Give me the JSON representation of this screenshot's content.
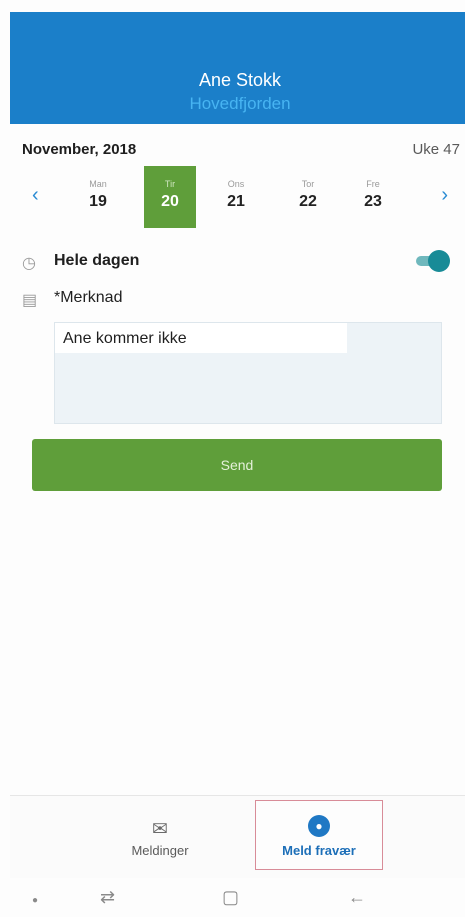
{
  "header": {
    "name": "Ane Stokk",
    "school": "Hovedfjorden"
  },
  "calendar": {
    "month": "November, 2018",
    "week": "Uke 47",
    "prev_icon": "chevron-left-icon",
    "next_icon": "chevron-right-icon",
    "days": [
      {
        "name": "Man",
        "num": "19"
      },
      {
        "name": "Tir",
        "num": "20"
      },
      {
        "name": "Ons",
        "num": "21"
      },
      {
        "name": "Tor",
        "num": "22"
      },
      {
        "name": "Fre",
        "num": "23"
      }
    ],
    "selected_day": "20"
  },
  "form": {
    "all_day_label": "Hele dagen",
    "all_day_on": true,
    "note_label": "*Merknad",
    "note_value": "Ane kommer ikke",
    "send_label": "Send"
  },
  "bottom_nav": {
    "items": [
      {
        "label": "Meldinger",
        "icon": "envelope-icon"
      },
      {
        "label": "Meld fravær",
        "icon": "report-absence-icon"
      }
    ],
    "active": "Meld fravær"
  },
  "colors": {
    "header": "#1b7fc9",
    "accent_green": "#5f9e3a",
    "toggle": "#188b97",
    "active_nav": "#1d6fb8"
  }
}
